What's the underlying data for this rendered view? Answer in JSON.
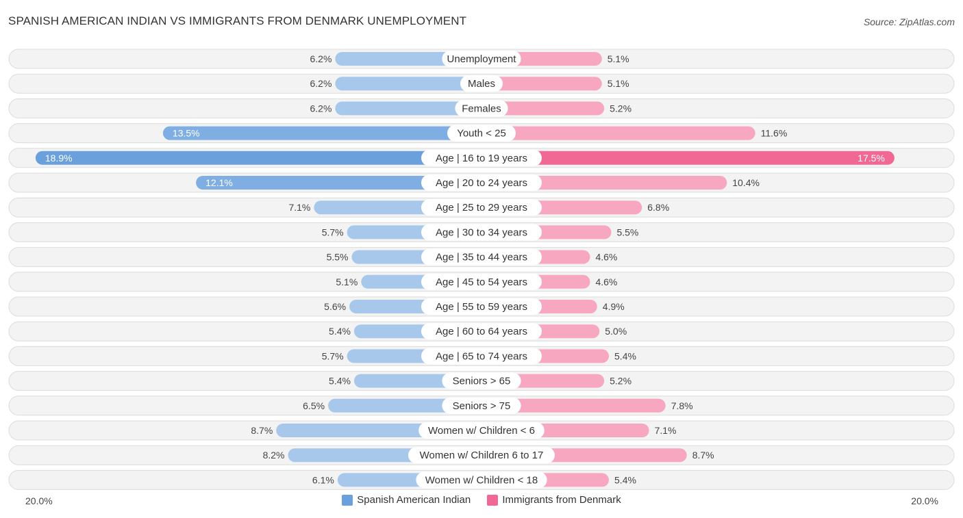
{
  "chart_data": {
    "type": "bar",
    "orientation": "diverging-horizontal",
    "title": "SPANISH AMERICAN INDIAN VS IMMIGRANTS FROM DENMARK UNEMPLOYMENT",
    "source": "Source: ZipAtlas.com",
    "categories": [
      "Unemployment",
      "Males",
      "Females",
      "Youth < 25",
      "Age | 16 to 19 years",
      "Age | 20 to 24 years",
      "Age | 25 to 29 years",
      "Age | 30 to 34 years",
      "Age | 35 to 44 years",
      "Age | 45 to 54 years",
      "Age | 55 to 59 years",
      "Age | 60 to 64 years",
      "Age | 65 to 74 years",
      "Seniors > 65",
      "Seniors > 75",
      "Women w/ Children < 6",
      "Women w/ Children 6 to 17",
      "Women w/ Children < 18"
    ],
    "series": [
      {
        "name": "Spanish American Indian",
        "color": "#6aa0dc",
        "light_color": "#a8c8eb",
        "values": [
          6.2,
          6.2,
          6.2,
          13.5,
          18.9,
          12.1,
          7.1,
          5.7,
          5.5,
          5.1,
          5.6,
          5.4,
          5.7,
          5.4,
          6.5,
          8.7,
          8.2,
          6.1
        ]
      },
      {
        "name": "Immigrants from Denmark",
        "color": "#f06893",
        "light_color": "#f7a8c0",
        "values": [
          5.1,
          5.1,
          5.2,
          11.6,
          17.5,
          10.4,
          6.8,
          5.5,
          4.6,
          4.6,
          4.9,
          5.0,
          5.4,
          5.2,
          7.8,
          7.1,
          8.7,
          5.4
        ]
      }
    ],
    "value_suffix": "%",
    "xlim": [
      -20,
      20
    ],
    "axis_labels": {
      "left": "20.0%",
      "right": "20.0%"
    },
    "legend_position": "bottom-center"
  }
}
